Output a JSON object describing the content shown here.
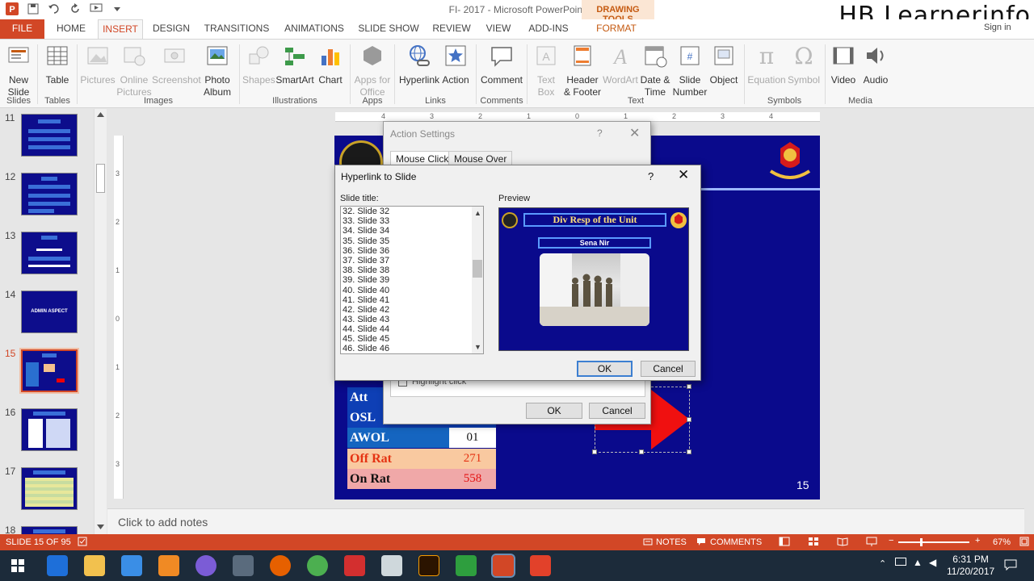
{
  "window": {
    "title": "FI- 2017 - Microsoft PowerPoint",
    "context_tab_title": "DRAWING TOOLS",
    "sign_in": "Sign in",
    "watermark": "HB Learnerinfo"
  },
  "tabs": [
    "FILE",
    "HOME",
    "INSERT",
    "DESIGN",
    "TRANSITIONS",
    "ANIMATIONS",
    "SLIDE SHOW",
    "REVIEW",
    "VIEW",
    "ADD-INS",
    "FORMAT"
  ],
  "ribbon": {
    "buttons": [
      {
        "l1": "New",
        "l2": "Slide"
      },
      {
        "l1": "Table",
        "l2": ""
      },
      {
        "l1": "Pictures",
        "l2": ""
      },
      {
        "l1": "Online",
        "l2": "Pictures"
      },
      {
        "l1": "Screenshot",
        "l2": ""
      },
      {
        "l1": "Photo",
        "l2": "Album"
      },
      {
        "l1": "Shapes",
        "l2": ""
      },
      {
        "l1": "SmartArt",
        "l2": ""
      },
      {
        "l1": "Chart",
        "l2": ""
      },
      {
        "l1": "Apps for",
        "l2": "Office"
      },
      {
        "l1": "Hyperlink",
        "l2": ""
      },
      {
        "l1": "Action",
        "l2": ""
      },
      {
        "l1": "Comment",
        "l2": ""
      },
      {
        "l1": "Text",
        "l2": "Box"
      },
      {
        "l1": "Header",
        "l2": "& Footer"
      },
      {
        "l1": "WordArt",
        "l2": ""
      },
      {
        "l1": "Date &",
        "l2": "Time"
      },
      {
        "l1": "Slide",
        "l2": "Number"
      },
      {
        "l1": "Object",
        "l2": ""
      },
      {
        "l1": "Equation",
        "l2": ""
      },
      {
        "l1": "Symbol",
        "l2": ""
      },
      {
        "l1": "Video",
        "l2": ""
      },
      {
        "l1": "Audio",
        "l2": ""
      }
    ],
    "groups": [
      "Slides",
      "Tables",
      "Images",
      "Illustrations",
      "Apps",
      "Links",
      "Comments",
      "Text",
      "Symbols",
      "Media"
    ]
  },
  "thumbnails": [
    {
      "num": "11",
      "label": ""
    },
    {
      "num": "12",
      "label": ""
    },
    {
      "num": "13",
      "label": ""
    },
    {
      "num": "14",
      "label": "ADMIN ASPECT"
    },
    {
      "num": "15",
      "label": ""
    },
    {
      "num": "16",
      "label": ""
    },
    {
      "num": "17",
      "label": ""
    },
    {
      "num": "18",
      "label": ""
    }
  ],
  "ruler": {
    "h": [
      "4",
      "3",
      "2",
      "1",
      "0",
      "1",
      "2",
      "3",
      "4"
    ],
    "v": [
      "3",
      "2",
      "1",
      "0",
      "1",
      "2",
      "3"
    ]
  },
  "slide": {
    "number": "15",
    "table": [
      {
        "label": "Att",
        "value": "",
        "c1_bg": "#0e3fb5",
        "c2_bg": "#0e3fb5",
        "c1_fg": "#ffffff",
        "c2_fg": "#ffffff"
      },
      {
        "label": "OSL",
        "value": "",
        "c1_bg": "#0e3fb5",
        "c2_bg": "#0e3fb5",
        "c1_fg": "#ffffff",
        "c2_fg": "#ffffff"
      },
      {
        "label": "AWOL",
        "value": "01",
        "c1_bg": "#1565c0",
        "c2_bg": "#ffffff",
        "c1_fg": "#ffffff",
        "c2_fg": "#111111"
      },
      {
        "label": "Off Rat",
        "value": "271",
        "c1_bg": "#f9c9a0",
        "c2_bg": "#f9c9a0",
        "c1_fg": "#e53212",
        "c2_fg": "#e53212"
      },
      {
        "label": "On Rat",
        "value": "558",
        "c1_bg": "#f0a8a8",
        "c2_bg": "#f0a8a8",
        "c1_fg": "#111111",
        "c2_fg": "#e31212"
      }
    ]
  },
  "action_settings": {
    "title": "Action Settings",
    "help": "?",
    "tab_mouse_click": "Mouse Click",
    "tab_mouse_over": "Mouse Over",
    "highlight_click": "Highlight click",
    "ok": "OK",
    "cancel": "Cancel"
  },
  "hyperlink_dialog": {
    "title": "Hyperlink to Slide",
    "help": "?",
    "slide_title_label": "Slide title:",
    "preview_label": "Preview",
    "slides": [
      "32. Slide 32",
      "33. Slide 33",
      "34. Slide 34",
      "35. Slide 35",
      "36. Slide 36",
      "37. Slide 37",
      "38. Slide 38",
      "39. Slide 39",
      "40. Slide 40",
      "41. Slide 41",
      "42. Slide 42",
      "43. Slide 43",
      "44. Slide 44",
      "45. Slide 45",
      "46. Slide 46"
    ],
    "preview_title": "Div Resp of the Unit",
    "preview_subtitle": "Sena Nir",
    "ok": "OK",
    "cancel": "Cancel"
  },
  "notes_placeholder": "Click to add notes",
  "status": {
    "slide_count": "SLIDE 15 OF 95",
    "notes": "NOTES",
    "comments": "COMMENTS",
    "zoom": "67%"
  },
  "taskbar": {
    "time": "6:31 PM",
    "date": "11/20/2017"
  },
  "colors": {
    "accent": "#d24726",
    "slide_bg": "#0a0a8c",
    "taskbar": "#1c2b3a"
  }
}
